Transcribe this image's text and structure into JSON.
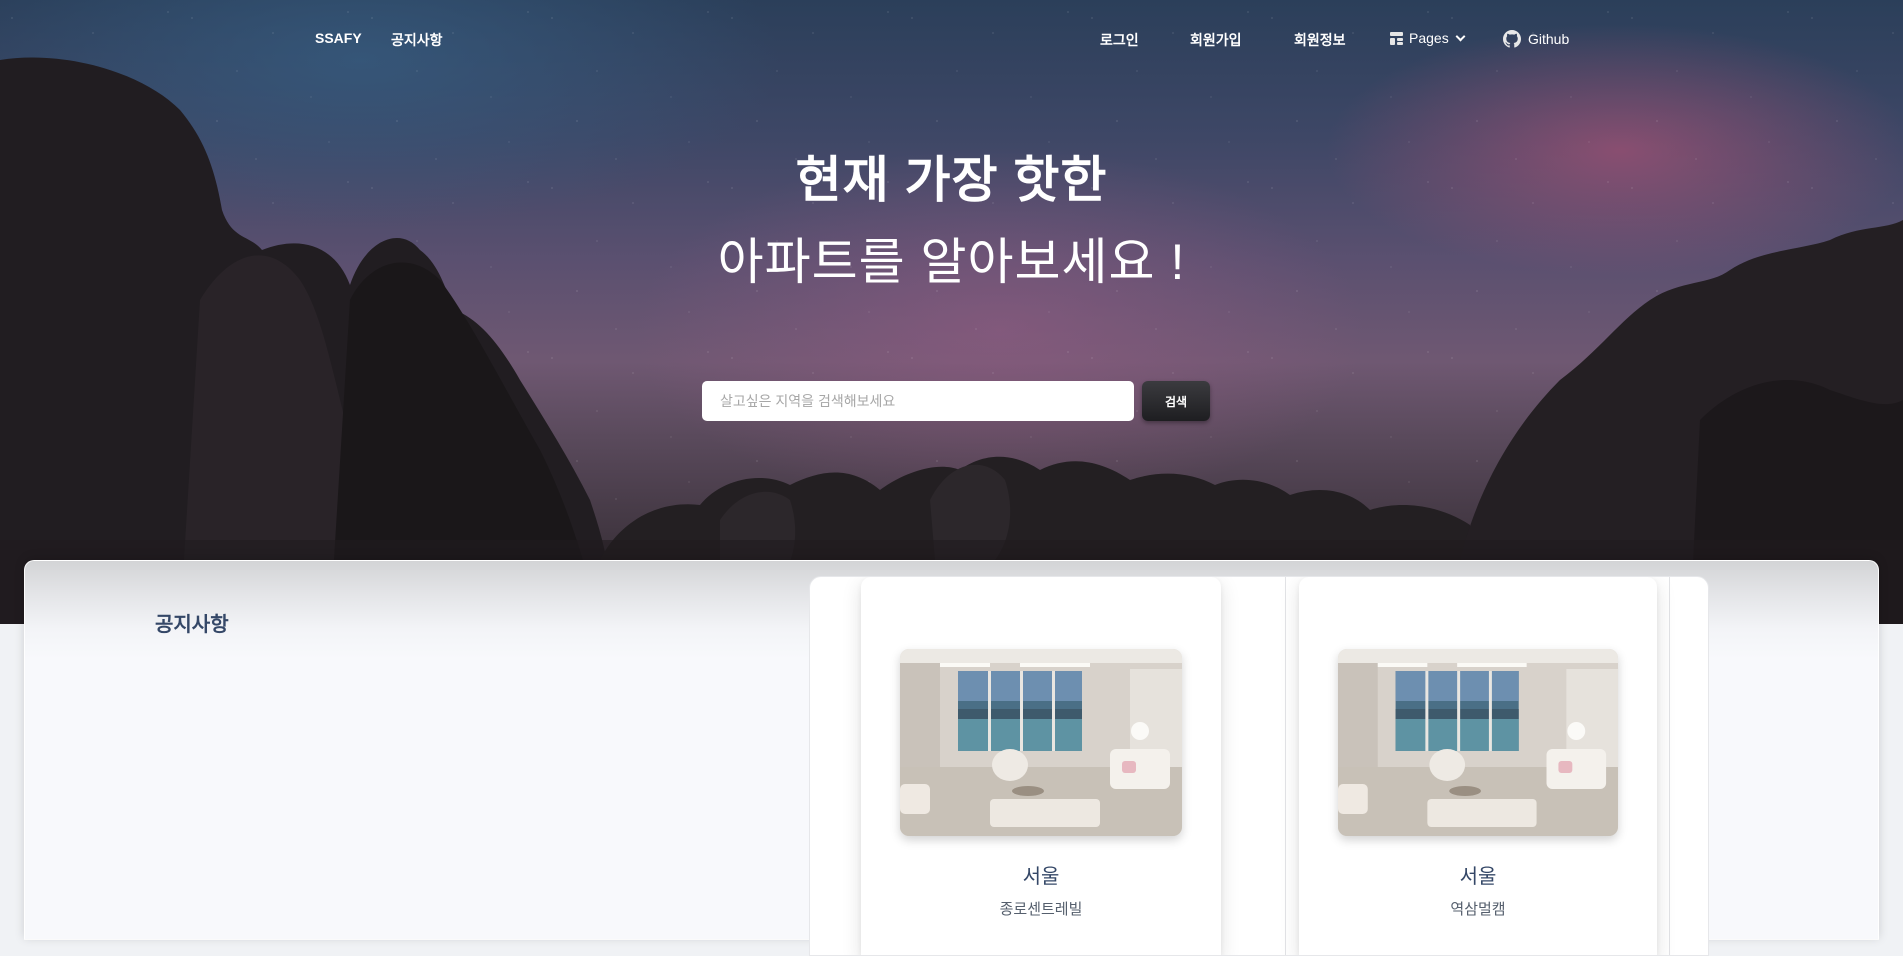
{
  "nav": {
    "brand": "SSAFY",
    "notice": "공지사항",
    "login": "로그인",
    "signup": "회원가입",
    "userinfo": "회원정보",
    "pages": "Pages",
    "github": "Github"
  },
  "hero": {
    "title": "현재 가장 핫한",
    "subtitle": "아파트를 알아보세요 !"
  },
  "search": {
    "placeholder": "살고싶은 지역을 검색해보세요",
    "button_label": "검색"
  },
  "notice_section": {
    "title": "공지사항"
  },
  "listings": [
    {
      "region": "서울",
      "name": "종로센트레빌"
    },
    {
      "region": "서울",
      "name": "역삼멀캠"
    }
  ],
  "colors": {
    "heading": "#344767",
    "search_button": "#2b2b2e",
    "panel_bg": "#f8f9fc"
  },
  "icons": {
    "pages": "pages-icon",
    "dropdown": "chevron-down-icon",
    "github": "github-icon"
  }
}
